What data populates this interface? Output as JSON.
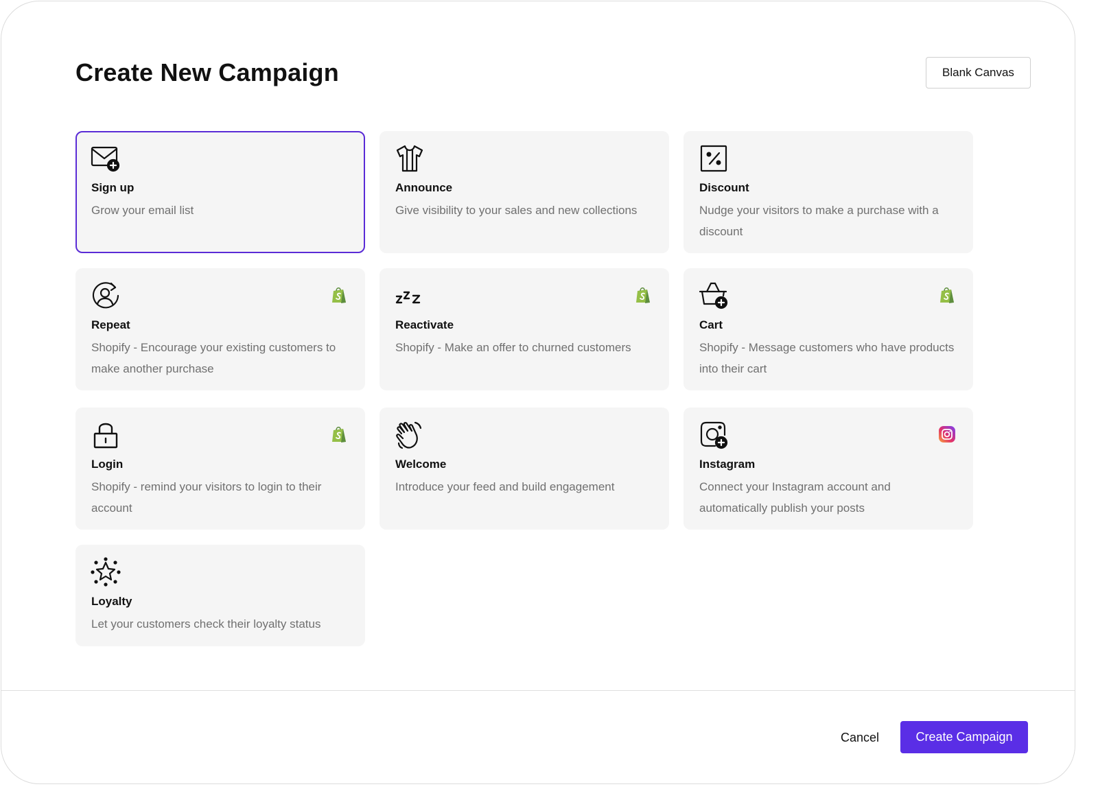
{
  "header": {
    "title": "Create New Campaign",
    "blank_canvas_label": "Blank Canvas"
  },
  "cards": [
    {
      "id": "signup",
      "name": "Sign up",
      "description": "Grow your email list",
      "icon": "envelope-plus-icon",
      "badge": null,
      "selected": true
    },
    {
      "id": "announce",
      "name": "Announce",
      "description": "Give visibility to your sales and new collections",
      "icon": "tshirt-icon",
      "badge": null,
      "selected": false
    },
    {
      "id": "discount",
      "name": "Discount",
      "description": "Nudge your visitors to make a purchase with a discount",
      "icon": "percent-tag-icon",
      "badge": null,
      "selected": false
    },
    {
      "id": "repeat",
      "name": "Repeat",
      "description": "Shopify - Encourage your existing customers to make another purchase",
      "icon": "user-refresh-icon",
      "badge": "shopify-icon",
      "selected": false
    },
    {
      "id": "reactivate",
      "name": "Reactivate",
      "description": "Shopify - Make an offer to churned customers",
      "icon": "sleep-zzz-icon",
      "badge": "shopify-icon",
      "selected": false
    },
    {
      "id": "cart",
      "name": "Cart",
      "description": "Shopify - Message customers who have products into their cart",
      "icon": "basket-plus-icon",
      "badge": "shopify-icon",
      "selected": false
    },
    {
      "id": "login",
      "name": "Login",
      "description": "Shopify - remind your visitors to login to their account",
      "icon": "padlock-icon",
      "badge": "shopify-icon",
      "selected": false
    },
    {
      "id": "welcome",
      "name": "Welcome",
      "description": "Introduce your feed and build engagement",
      "icon": "waving-hand-icon",
      "badge": null,
      "selected": false
    },
    {
      "id": "instagram",
      "name": "Instagram",
      "description": "Connect your Instagram account and automatically publish your posts",
      "icon": "instagram-plus-icon",
      "badge": "instagram-icon",
      "selected": false
    },
    {
      "id": "loyalty",
      "name": "Loyalty",
      "description": "Let your customers check their loyalty status",
      "icon": "star-sparkle-icon",
      "badge": null,
      "selected": false
    }
  ],
  "footer": {
    "cancel_label": "Cancel",
    "create_label": "Create Campaign"
  },
  "colors": {
    "accent": "#5a2ee6",
    "selected_border": "#5a2bd6",
    "card_bg": "#f5f5f5",
    "shopify_green": "#95bf47"
  }
}
